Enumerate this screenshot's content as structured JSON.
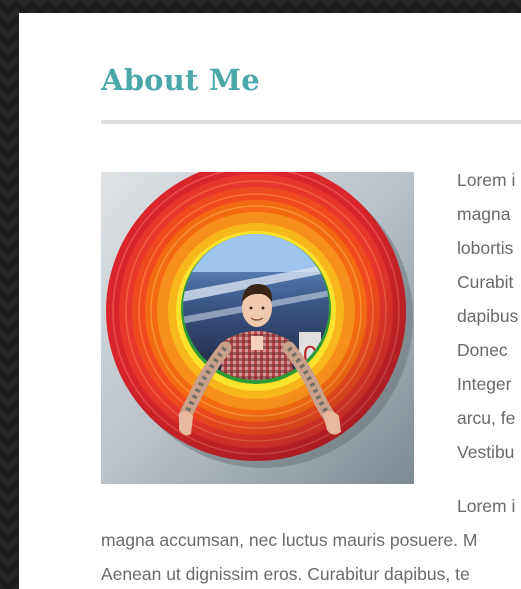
{
  "page": {
    "title": "About Me"
  },
  "profile_photo": {
    "alt": "Person in plaid shirt posing through a rainbow ring sculpture"
  },
  "paragraph_1": {
    "lines": [
      "Lorem i",
      "magna ",
      "lobortis",
      "Curabit",
      "dapibus",
      "Donec ",
      "Integer",
      "arcu, fe",
      "Vestibu"
    ]
  },
  "paragraph_2": {
    "lines": [
      "Lorem i",
      "magna accumsan, nec luctus mauris posuere. M",
      "Aenean ut dignissim eros. Curabitur dapibus, te"
    ]
  },
  "colors": {
    "title": "#4aa8a8",
    "body_text": "#6a6a6a",
    "rule": "#e0e0e0",
    "panel": "#ffffff",
    "background": "#1c1c1c"
  }
}
